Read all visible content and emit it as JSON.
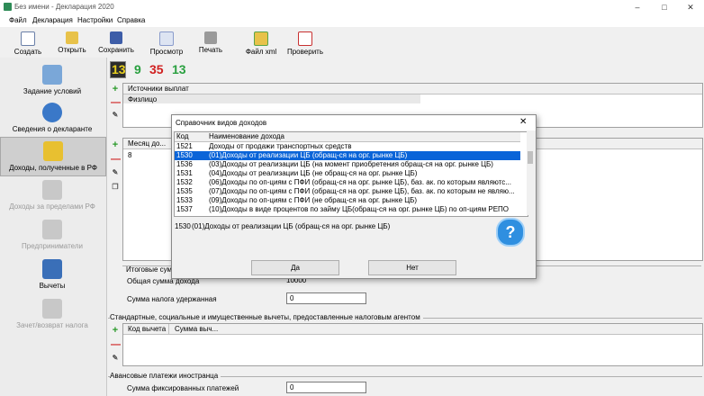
{
  "window": {
    "title": "Без имени - Декларация 2020"
  },
  "menu": [
    "Файл",
    "Декларация",
    "Настройки",
    "Справка"
  ],
  "toolbar": [
    {
      "label": "Создать",
      "icon": "new-doc-icon"
    },
    {
      "label": "Открыть",
      "icon": "open-folder-icon"
    },
    {
      "label": "Сохранить",
      "icon": "save-icon"
    },
    {
      "label": "Просмотр",
      "icon": "preview-icon"
    },
    {
      "label": "Печать",
      "icon": "print-icon"
    },
    {
      "label": "Файл xml",
      "icon": "xml-file-icon"
    },
    {
      "label": "Проверить",
      "icon": "check-icon"
    }
  ],
  "sidebar": [
    {
      "label": "Задание условий",
      "enabled": true
    },
    {
      "label": "Сведения о декларанте",
      "enabled": true
    },
    {
      "label": "Доходы, полученные в РФ",
      "enabled": true,
      "active": true
    },
    {
      "label": "Доходы за пределами РФ",
      "enabled": false
    },
    {
      "label": "Предприниматели",
      "enabled": false
    },
    {
      "label": "Вычеты",
      "enabled": true
    },
    {
      "label": "Зачет/возврат налога",
      "enabled": false
    }
  ],
  "rates": [
    "13",
    "9",
    "35",
    "13"
  ],
  "sources": {
    "header": "Источники выплат",
    "row": "Физлицо"
  },
  "income": {
    "month_header": "Месяц до...",
    "month_value": "8"
  },
  "totals": {
    "section": "Итоговые сум...",
    "income_label": "Общая сумма дохода",
    "income_value": "10000",
    "tax_label": "Сумма налога удержанная",
    "tax_value": "0"
  },
  "deductions": {
    "section": "Стандартные, социальные и имущественные вычеты, предоставленные налоговым агентом",
    "col_code": "Код вычета",
    "col_sum": "Сумма выч..."
  },
  "advance": {
    "section": "Авансовые платежи иностранца",
    "label": "Сумма фиксированных платежей",
    "value": "0"
  },
  "dialog": {
    "title": "Справочник видов доходов",
    "col_code": "Код",
    "col_name": "Наименование дохода",
    "rows": [
      {
        "code": "1521",
        "name": "Доходы от продажи транспортных средств"
      },
      {
        "code": "1530",
        "name": "(01)Доходы от реализации ЦБ (обращ-ся на орг. рынке ЦБ)",
        "selected": true
      },
      {
        "code": "1536",
        "name": "(03)Доходы от реализации ЦБ (на момент приобретения обращ-ся на орг. рынке ЦБ)"
      },
      {
        "code": "1531",
        "name": "(04)Доходы от реализации ЦБ (не обращ-ся на орг. рынке ЦБ)"
      },
      {
        "code": "1532",
        "name": "(06)Доходы по оп-циям с ПФИ (обращ-ся на орг. рынке ЦБ), баз. ак. по которым являютс..."
      },
      {
        "code": "1535",
        "name": "(07)Доходы по оп-циям с ПФИ (обращ-ся на орг. рынке ЦБ), баз. ак. по которым не являю..."
      },
      {
        "code": "1533",
        "name": "(09)Доходы по оп-циям с ПФИ (не обращ-ся на орг. рынке ЦБ)"
      },
      {
        "code": "1537",
        "name": "(10)Доходы в виде процентов по займу ЦБ(обращ-ся на орг. рынке ЦБ) по оп-циям РЕПО"
      }
    ],
    "selected_code": "1530",
    "selected_name": "(01)Доходы от реализации ЦБ (обращ-ся на орг. рынке ЦБ)",
    "yes": "Да",
    "no": "Нет"
  }
}
